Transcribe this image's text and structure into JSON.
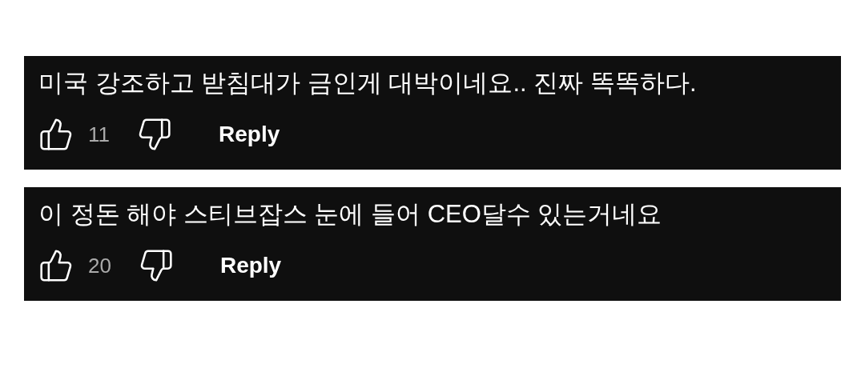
{
  "comments": [
    {
      "text": "미국 강조하고 받침대가 금인게 대박이네요.. 진짜 똑똑하다.",
      "like_count": "11",
      "reply": "Reply"
    },
    {
      "text": "이 정돈 해야 스티브잡스 눈에 들어 CEO달수 있는거네요",
      "like_count": "20",
      "reply": "Reply"
    }
  ]
}
